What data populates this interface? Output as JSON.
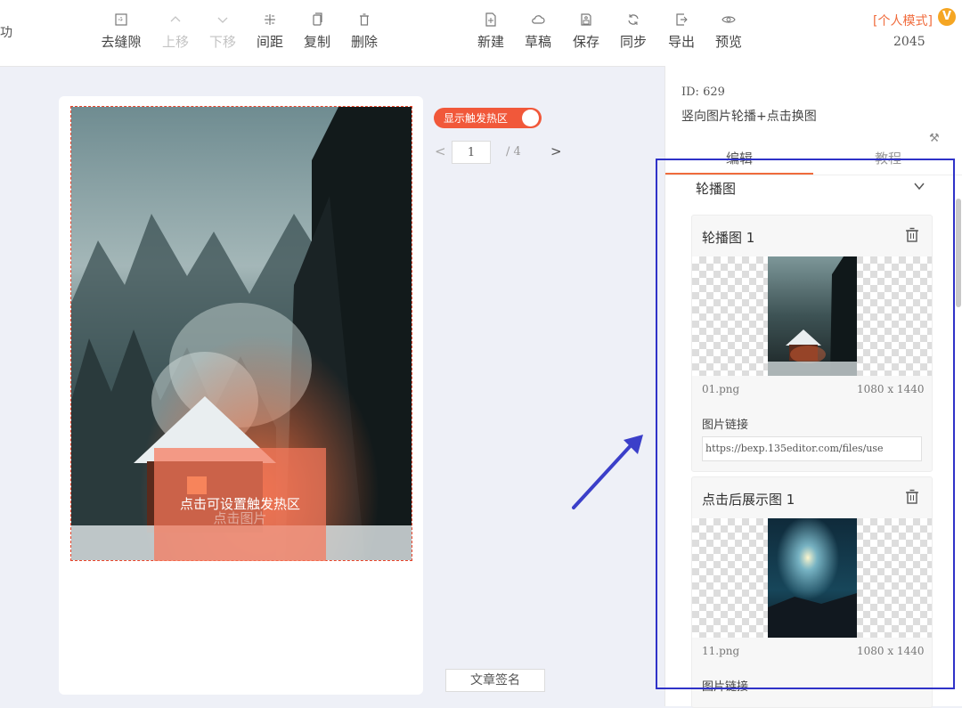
{
  "toolbar": {
    "left_stub": "功",
    "buttons": [
      {
        "label": "去缝隙",
        "icon": "gap-icon"
      },
      {
        "label": "上移",
        "icon": "chevron-up-icon"
      },
      {
        "label": "下移",
        "icon": "chevron-down-icon"
      },
      {
        "label": "间距",
        "icon": "spacing-icon"
      },
      {
        "label": "复制",
        "icon": "copy-icon"
      },
      {
        "label": "删除",
        "icon": "trash-icon"
      },
      {
        "label": "新建",
        "icon": "new-file-icon"
      },
      {
        "label": "草稿",
        "icon": "cloud-icon"
      },
      {
        "label": "保存",
        "icon": "save-icon"
      },
      {
        "label": "同步",
        "icon": "sync-icon"
      },
      {
        "label": "导出",
        "icon": "export-icon"
      },
      {
        "label": "预览",
        "icon": "eye-icon"
      }
    ],
    "mode_label": "[个人模式]",
    "vip_badge": "V",
    "count": "2045"
  },
  "canvas": {
    "hotspot_text": "点击可设置触发热区",
    "hotspot_ghost": "点击图片"
  },
  "controls": {
    "toggle_label": "显示触发热区",
    "toggle_on": true,
    "page_current": "1",
    "page_total": "/ 4",
    "signature_label": "文章签名"
  },
  "panel": {
    "id_text": "ID: 629",
    "name": "竖向图片轮播+点击换图",
    "tabs": [
      "编辑",
      "教程"
    ],
    "active_tab": "编辑",
    "section_title": "轮播图",
    "items": [
      {
        "title": "轮播图 1",
        "file": "01.png",
        "dims": "1080 x 1440",
        "link_label": "图片链接",
        "link_value": "https://bexp.135editor.com/files/use"
      },
      {
        "title": "点击后展示图 1",
        "file": "11.png",
        "dims": "1080 x 1440",
        "link_label": "图片链接",
        "link_value": ""
      }
    ]
  },
  "colors": {
    "accent": "#f06b3c",
    "toggle": "#f1583a",
    "highlight_box": "#2f32c8",
    "hotspot": "#f6785c"
  }
}
